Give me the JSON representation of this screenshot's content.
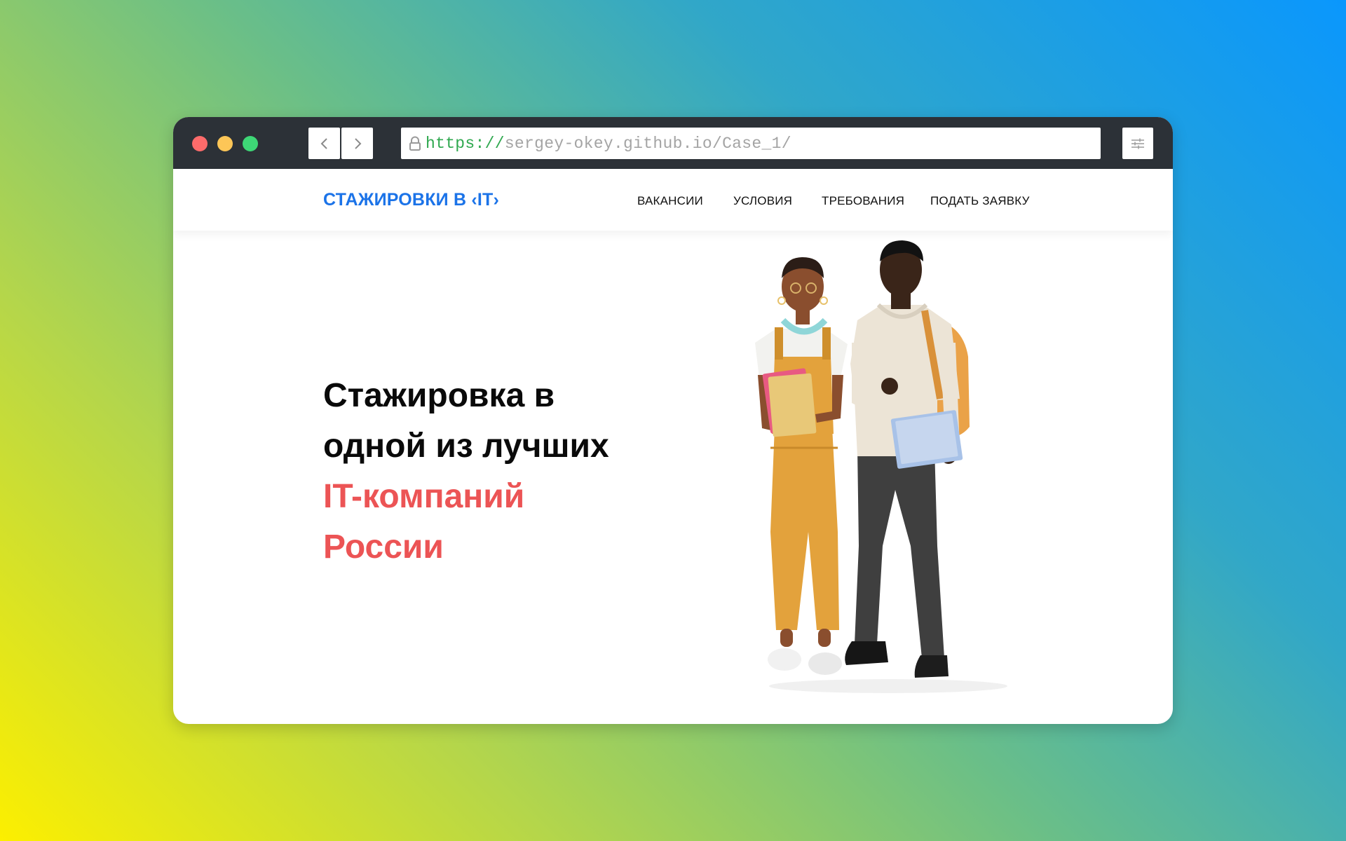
{
  "browser": {
    "url_protocol": "https://",
    "url_rest": "sergey-okey.github.io/Case_1/",
    "icons": {
      "back": "chevron-left-icon",
      "forward": "chevron-right-icon",
      "lock": "lock-icon",
      "menu": "sliders-icon"
    }
  },
  "site": {
    "logo": "СТАЖИРОВКИ В ‹IT›",
    "nav": [
      "ВАКАНСИИ",
      "УСЛОВИЯ",
      "ТРЕБОВАНИЯ",
      "ПОДАТЬ ЗАЯВКУ"
    ]
  },
  "hero": {
    "line1": "Стажировка в",
    "line2": "одной из лучших",
    "accent1": "IT-компаний",
    "accent2": "России"
  },
  "colors": {
    "brand_blue": "#1b73e8",
    "accent_red": "#ec5455",
    "titlebar": "#2c3137"
  }
}
